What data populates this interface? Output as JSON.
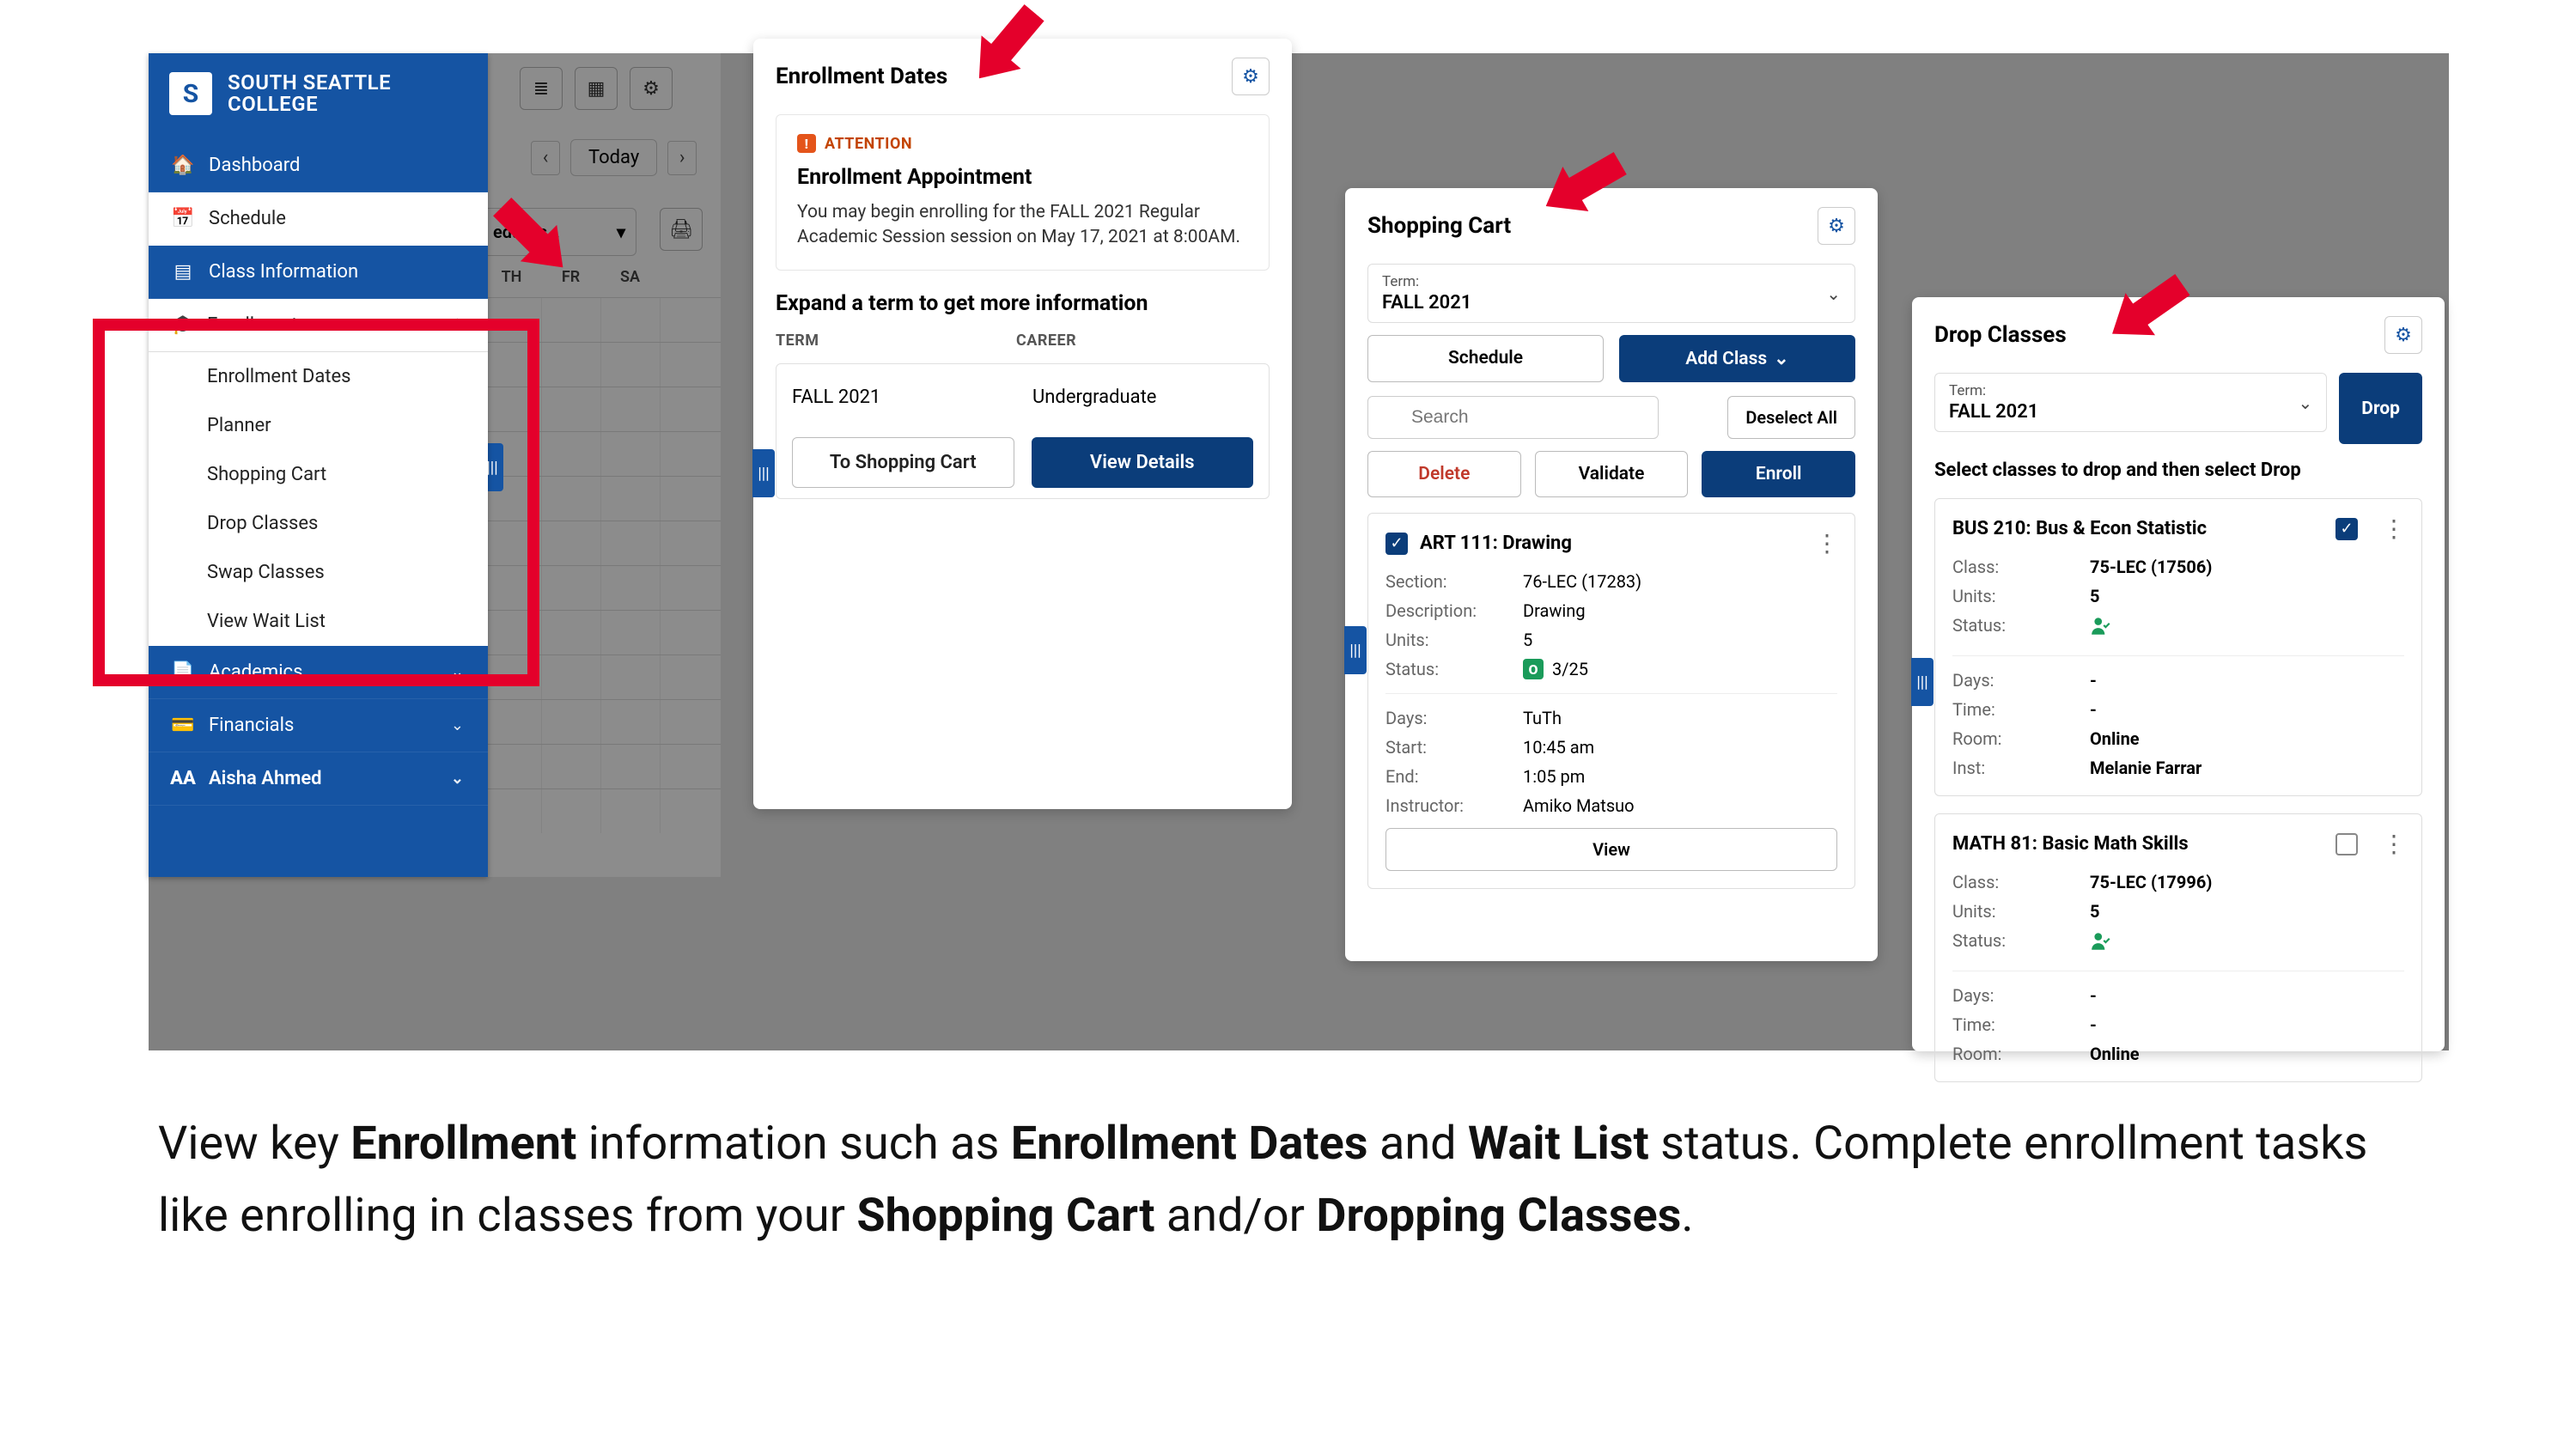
{
  "sidebar": {
    "brand_line1": "SOUTH SEATTLE",
    "brand_line2": "COLLEGE",
    "items": {
      "dashboard": "Dashboard",
      "schedule": "Schedule",
      "class_info": "Class Information",
      "enrollment": "Enrollment",
      "academics": "Academics",
      "financials": "Financials"
    },
    "enrollment_sub": [
      "Enrollment Dates",
      "Planner",
      "Shopping Cart",
      "Drop Classes",
      "Swap Classes",
      "View Wait List"
    ],
    "user_name": "Aisha Ahmed",
    "user_initials": "AA"
  },
  "calendar": {
    "today": "Today",
    "select_label": "edul…s…",
    "days": [
      "TH",
      "FR",
      "SA"
    ]
  },
  "enrollment_dates": {
    "title": "Enrollment Dates",
    "attention_tag": "ATTENTION",
    "attention_title": "Enrollment Appointment",
    "attention_msg": "You may begin enrolling for the FALL 2021 Regular Academic Session session on May 17, 2021 at 8:00AM.",
    "expand_title": "Expand a term to get more information",
    "col_term": "TERM",
    "col_career": "CAREER",
    "row_term": "FALL 2021",
    "row_career": "Undergraduate",
    "btn_cart": "To Shopping Cart",
    "btn_details": "View Details"
  },
  "shopping_cart": {
    "title": "Shopping Cart",
    "term_label": "Term:",
    "term_value": "FALL 2021",
    "btn_schedule": "Schedule",
    "btn_add": "Add Class",
    "search_placeholder": "Search",
    "btn_deselect": "Deselect All",
    "btn_delete": "Delete",
    "btn_validate": "Validate",
    "btn_enroll": "Enroll",
    "course": {
      "title": "ART 111: Drawing",
      "section_k": "Section:",
      "section_v": "76-LEC (17283)",
      "desc_k": "Description:",
      "desc_v": "Drawing",
      "units_k": "Units:",
      "units_v": "5",
      "status_k": "Status:",
      "status_v": "3/25",
      "days_k": "Days:",
      "days_v": "TuTh",
      "start_k": "Start:",
      "start_v": "10:45 am",
      "end_k": "End:",
      "end_v": "1:05 pm",
      "inst_k": "Instructor:",
      "inst_v": "Amiko Matsuo",
      "view": "View"
    }
  },
  "drop_classes": {
    "title": "Drop Classes",
    "term_label": "Term:",
    "term_value": "FALL 2021",
    "btn_drop": "Drop",
    "instruction": "Select classes to drop and then select Drop",
    "c1": {
      "title": "BUS 210: Bus & Econ Statistic",
      "class_k": "Class:",
      "class_v": "75-LEC (17506)",
      "units_k": "Units:",
      "units_v": "5",
      "status_k": "Status:",
      "days_k": "Days:",
      "days_v": "-",
      "time_k": "Time:",
      "time_v": "-",
      "room_k": "Room:",
      "room_v": "Online",
      "inst_k": "Inst:",
      "inst_v": "Melanie Farrar"
    },
    "c2": {
      "title": "MATH 81: Basic Math Skills",
      "class_k": "Class:",
      "class_v": "75-LEC (17996)",
      "units_k": "Units:",
      "units_v": "5",
      "status_k": "Status:",
      "days_k": "Days:",
      "days_v": "-",
      "time_k": "Time:",
      "time_v": "-",
      "room_k": "Room:",
      "room_v": "Online"
    }
  },
  "caption": {
    "pre1": "View key ",
    "b1": "Enrollment",
    "mid1": " information such as ",
    "b2": "Enrollment Dates",
    "mid2": " and ",
    "b3": "Wait List",
    "post1": " status. Complete enrollment tasks like enrolling in classes from your ",
    "b4": "Shopping Cart",
    "mid3": " and/or ",
    "b5": "Dropping Classes",
    "end": "."
  }
}
